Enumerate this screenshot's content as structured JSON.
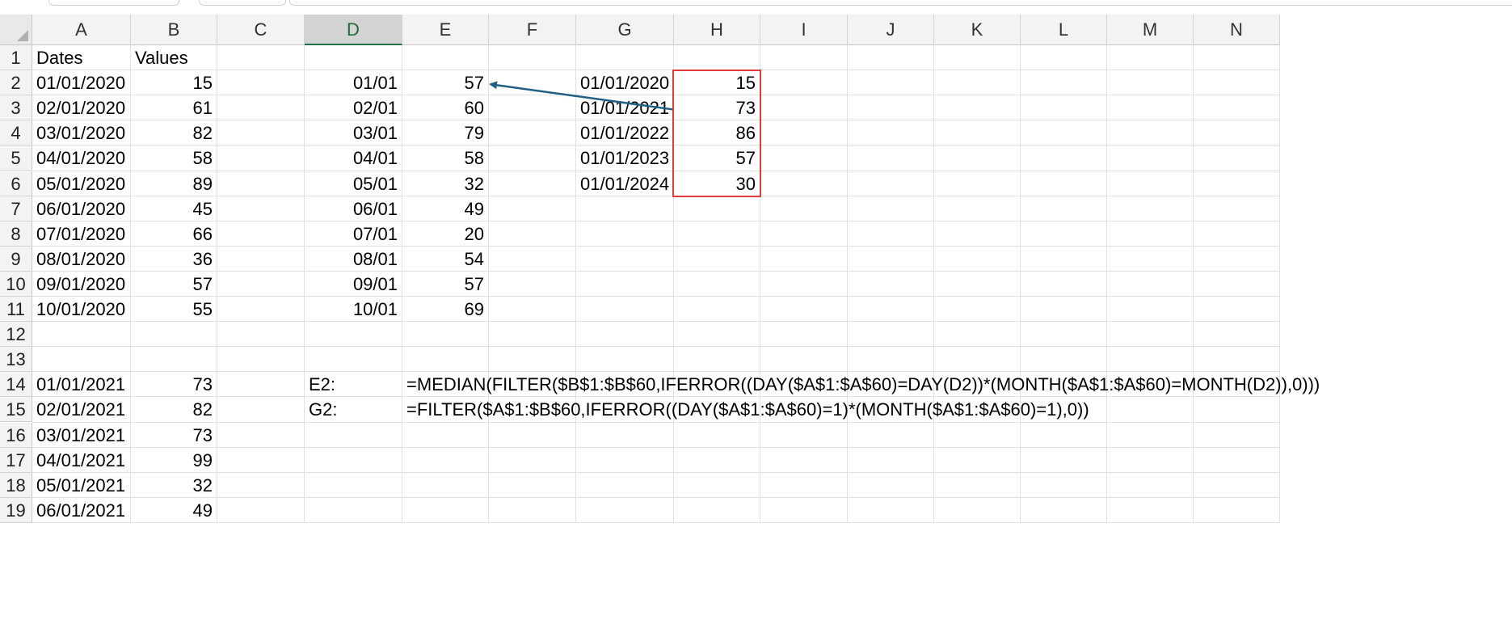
{
  "columns": [
    "A",
    "B",
    "C",
    "D",
    "E",
    "F",
    "G",
    "H",
    "I",
    "J",
    "K",
    "L",
    "M",
    "N"
  ],
  "active_column": "D",
  "rows": [
    "1",
    "2",
    "3",
    "4",
    "5",
    "6",
    "7",
    "8",
    "9",
    "10",
    "11",
    "12",
    "13",
    "14",
    "15",
    "16",
    "17",
    "18",
    "19"
  ],
  "cells": {
    "A1": "Dates",
    "B1": "Values",
    "A2": "01/01/2020",
    "B2": "15",
    "D2": "01/01",
    "E2": "57",
    "G2": "01/01/2020",
    "H2": "15",
    "A3": "02/01/2020",
    "B3": "61",
    "D3": "02/01",
    "E3": "60",
    "G3": "01/01/2021",
    "H3": "73",
    "A4": "03/01/2020",
    "B4": "82",
    "D4": "03/01",
    "E4": "79",
    "G4": "01/01/2022",
    "H4": "86",
    "A5": "04/01/2020",
    "B5": "58",
    "D5": "04/01",
    "E5": "58",
    "G5": "01/01/2023",
    "H5": "57",
    "A6": "05/01/2020",
    "B6": "89",
    "D6": "05/01",
    "E6": "32",
    "G6": "01/01/2024",
    "H6": "30",
    "A7": "06/01/2020",
    "B7": "45",
    "D7": "06/01",
    "E7": "49",
    "A8": "07/01/2020",
    "B8": "66",
    "D8": "07/01",
    "E8": "20",
    "A9": "08/01/2020",
    "B9": "36",
    "D9": "08/01",
    "E9": "54",
    "A10": "09/01/2020",
    "B10": "57",
    "D10": "09/01",
    "E10": "57",
    "A11": "10/01/2020",
    "B11": "55",
    "D11": "10/01",
    "E11": "69",
    "A14": "01/01/2021",
    "B14": "73",
    "D14": "E2:",
    "E14": "=MEDIAN(FILTER($B$1:$B$60,IFERROR((DAY($A$1:$A$60)=DAY(D2))*(MONTH($A$1:$A$60)=MONTH(D2)),0)))",
    "A15": "02/01/2021",
    "B15": "82",
    "D15": "G2:",
    "E15": "=FILTER($A$1:$B$60,IFERROR((DAY($A$1:$A$60)=1)*(MONTH($A$1:$A$60)=1),0))",
    "A16": "03/01/2021",
    "B16": "73",
    "A17": "04/01/2021",
    "B17": "99",
    "A18": "05/01/2021",
    "B18": "32",
    "A19": "06/01/2021",
    "B19": "49"
  },
  "left_aligned_cells": [
    "A1",
    "B1",
    "A2",
    "A3",
    "A4",
    "A5",
    "A6",
    "A7",
    "A8",
    "A9",
    "A10",
    "A11",
    "A14",
    "A15",
    "A16",
    "A17",
    "A18",
    "A19",
    "D14",
    "D15",
    "E14",
    "E15",
    "G2",
    "G3",
    "G4",
    "G5",
    "G6"
  ],
  "highlight_range": "H2:H6",
  "highlight_color": "#e03c3c",
  "arrow_color": "#1f5f86",
  "arrow_from": "H3",
  "arrow_to": "E2"
}
